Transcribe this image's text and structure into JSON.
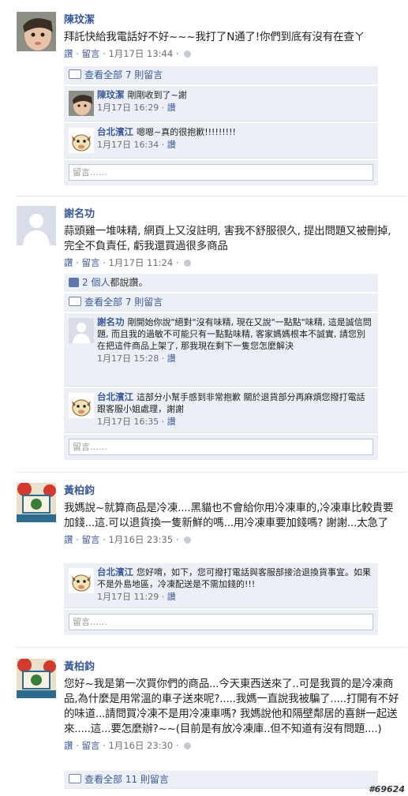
{
  "common": {
    "like": "讚",
    "reply": "留言",
    "sep": "·",
    "comment_placeholder": "留言……"
  },
  "posts": [
    {
      "author": "陳玟潔",
      "text": "拜託快給我電話好不好~~~我打了N通了!你們到底有沒有在查ㄚ",
      "time": "1月17日 13:44",
      "view_all": "查看全部 7 則留言",
      "comments": [
        {
          "name": "陳玟潔",
          "text": "剛剛收到了~謝",
          "time": "1月17日 16:29"
        },
        {
          "name": "台北濱江",
          "text": "嗯嗯~真的很抱歉!!!!!!!!!",
          "time": "1月17日 16:34"
        }
      ]
    },
    {
      "author": "謝名功",
      "text": "蒜頭雞一堆味精, 網頁上又沒註明, 害我不舒服很久, 提出問題又被刪掉, 完全不負責任, 虧我還買過很多商品",
      "time": "1月17日 11:24",
      "likes_count": "2 個人",
      "likes_suffix": "都說讚。",
      "view_all": "查看全部 7 則留言",
      "comments": [
        {
          "name": "謝名功",
          "text": "剛開始你說\"絕對\"沒有味精, 現在又說\"一點點\"味精, 這是誠信問題, 而且我的過敏不可能只有一點點味精, 客家媽媽根本不誠實, 請您別在把這件商品上架了, 那我現在剩下一隻您怎麼解決",
          "time": "1月17日 15:28"
        },
        {
          "name": "台北濱江",
          "text": "這部分小幫手感到非常抱歉 關於退貨部分再麻煩您撥打電話跟客服小姐處理，謝謝",
          "time": "1月17日 16:35"
        }
      ]
    },
    {
      "author": "黃柏鈞",
      "text": "我媽說~就算商品是冷凍....黑貓也不會給你用冷凍車的,冷凍車比較貴要加錢...這.可以退貨換一隻新鮮的嗎...用冷凍車要加錢嗎? 謝謝...太急了",
      "time": "1月16日 23:35",
      "comments": [
        {
          "name": "台北濱江",
          "text": "您好唷，如下，您可撥打電話與客服部接洽退換貨事宜。如果不是外島地區，冷凍配送是不需加錢的!!!",
          "time": "1月17日 11:29"
        }
      ]
    },
    {
      "author": "黃柏鈞",
      "text": "您好~我是第一次買你們的商品...今天東西送來了..可是我買的是冷凍商品,為什麼是用常溫的車子送來呢?.....我媽一直說我被騙了.....打開有不好的味道...請問買冷凍不是用冷凍車嗎? 我媽說他和隔壁鄰居的喜餅一起送來.....這...要怎麼辦?~~(目前是有放冷凍庫..但不知道有沒有問題....)",
      "time": "1月16日 23:30",
      "view_all": "查看全部 11 則留言"
    }
  ],
  "watermark": "#69624"
}
